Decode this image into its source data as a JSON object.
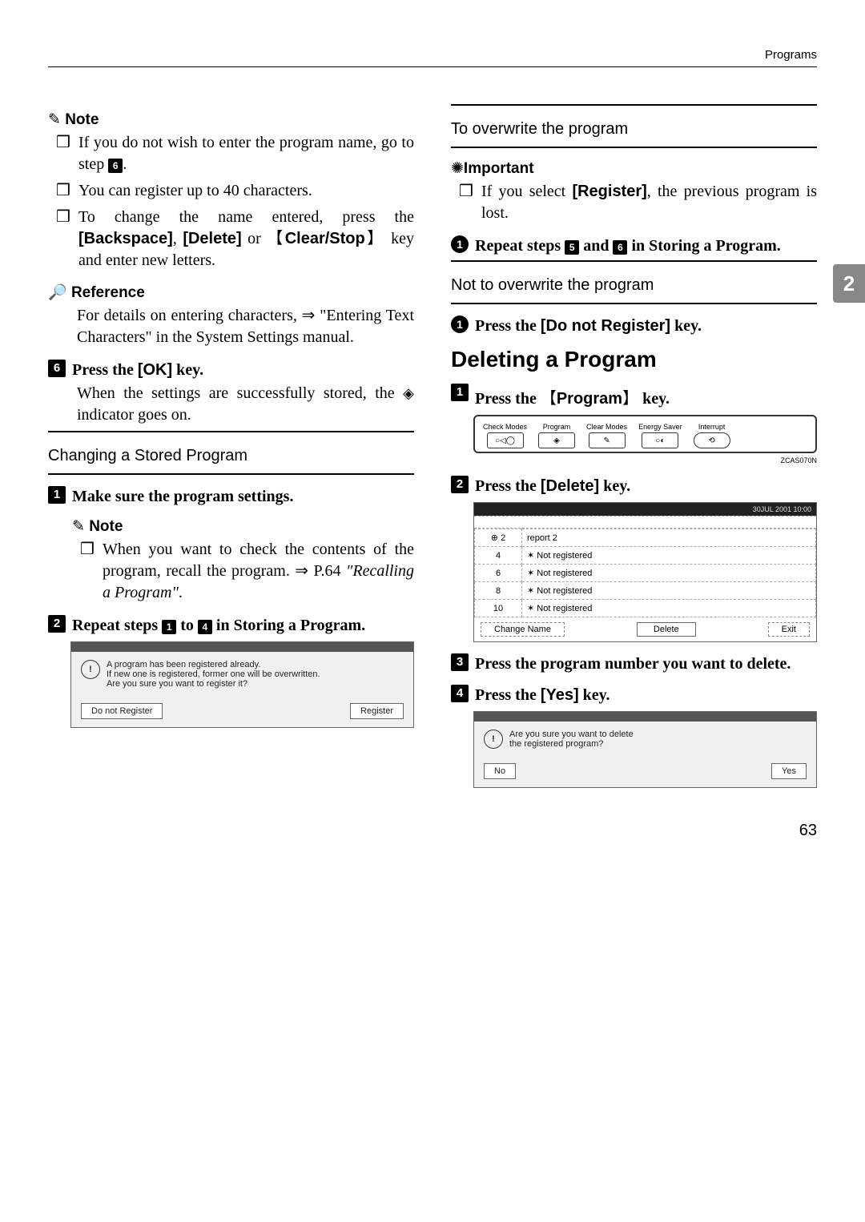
{
  "header": {
    "section": "Programs"
  },
  "pagetab": "2",
  "left": {
    "note_label": "Note",
    "note_items": [
      "If you do not wish to enter the program name, go to step ",
      "You can register up to 40 characters.",
      "To change the name entered, press the "
    ],
    "note_item0_badge": "6",
    "note_item0_tail": ".",
    "note_item2_kw1": "[Backspace]",
    "note_item2_mid": ", ",
    "note_item2_kw2": "[Delete]",
    "note_item2_or": " or ",
    "note_item2_kw3": "Clear/Stop",
    "note_item2_tail": " key and enter new letters.",
    "ref_label": "Reference",
    "ref_body": "For details on entering characters, ⇒ \"Entering Text Characters\" in the System Settings manual.",
    "step6_badge": "6",
    "step6_text_a": "Press the ",
    "step6_kw": "[OK]",
    "step6_text_b": " key.",
    "step6_body_a": "When the settings are successfully stored, the ",
    "step6_body_b": " indicator goes on.",
    "changing_head": "Changing a Stored Program",
    "cstep1_badge": "1",
    "cstep1_text": "Make sure the program settings.",
    "cnote_label": "Note",
    "cnote_item_a": "When you want to check the contents of the program, recall the program. ⇒ P.64 ",
    "cnote_item_b": "\"Recalling a Program\"",
    "cnote_item_c": ".",
    "cstep2_badge": "2",
    "cstep2_text_a": "Repeat steps ",
    "cstep2_b1": "1",
    "cstep2_mid": " to ",
    "cstep2_b2": "4",
    "cstep2_text_b": " in Storing a Program.",
    "dlg_line1": "A program has been registered already.",
    "dlg_line2": "If new one is registered, former one will be overwritten.",
    "dlg_line3": "Are you sure you want to register it?",
    "dlg_btn_left": "Do not Register",
    "dlg_btn_right": "Register"
  },
  "right": {
    "ow_head": "To overwrite the program",
    "imp_label": "Important",
    "imp_item_a": "If you select ",
    "imp_kw": "[Register]",
    "imp_item_b": ", the previous program is lost.",
    "ow_step_badge": "1",
    "ow_step_a": "Repeat steps ",
    "ow_b1": "5",
    "ow_mid": " and ",
    "ow_b2": "6",
    "ow_step_b": " in Storing a Program.",
    "noow_head": "Not to overwrite the program",
    "noow_badge": "1",
    "noow_a": "Press the ",
    "noow_kw": "[Do not Register]",
    "noow_b": " key.",
    "del_h2": "Deleting a Program",
    "d1_badge": "1",
    "d1_a": "Press the ",
    "d1_kw": "Program",
    "d1_b": " key.",
    "device_keys": [
      "Check Modes",
      "Program",
      "Clear Modes",
      "Energy Saver",
      "Interrupt"
    ],
    "zcap": "ZCAS070N",
    "d2_badge": "2",
    "d2_a": "Press the ",
    "d2_kw": "[Delete]",
    "d2_b": " key.",
    "list_top": "30JUL 2001  10:00",
    "list_rows": [
      {
        "n": "⊕ 2",
        "t": "report 2"
      },
      {
        "n": "4",
        "t": "✶ Not registered"
      },
      {
        "n": "6",
        "t": "✶ Not registered"
      },
      {
        "n": "8",
        "t": "✶ Not registered"
      },
      {
        "n": "10",
        "t": "✶ Not registered"
      }
    ],
    "list_foot_left": "Change Name",
    "list_foot_mid": "Delete",
    "list_foot_right": "Exit",
    "d3_badge": "3",
    "d3_text": "Press the program number you want to delete.",
    "d4_badge": "4",
    "d4_a": "Press the ",
    "d4_kw": "[Yes]",
    "d4_b": " key.",
    "dlg2_line1": "Are you sure you want to delete",
    "dlg2_line2": "the registered program?",
    "dlg2_left": "No",
    "dlg2_right": "Yes"
  },
  "page_number": "63"
}
